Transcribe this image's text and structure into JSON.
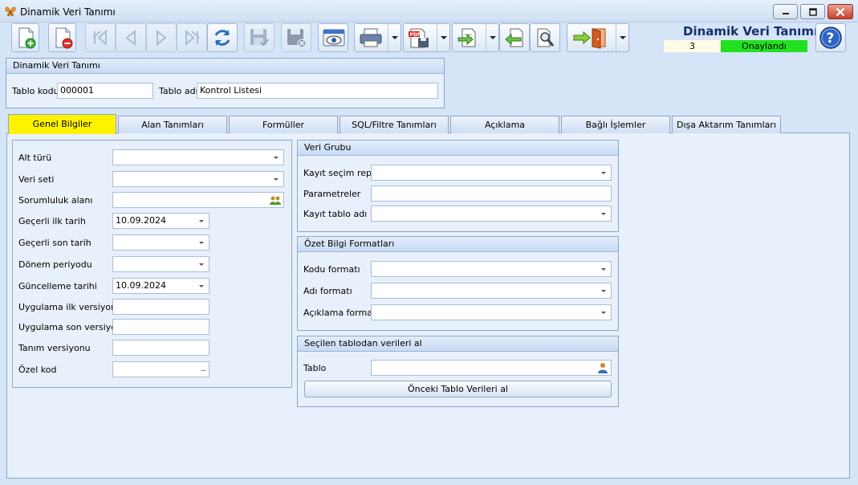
{
  "window": {
    "title": "Dinamik Veri Tanımı",
    "controls": [
      "minimize",
      "maximize",
      "close"
    ]
  },
  "toolbar": {
    "buttons": [
      {
        "icon": "new-document-icon",
        "enabled": true
      },
      {
        "icon": "delete-document-icon",
        "enabled": true
      },
      {
        "icon": "first-record-icon",
        "enabled": false
      },
      {
        "icon": "previous-record-icon",
        "enabled": false
      },
      {
        "icon": "next-record-icon",
        "enabled": false
      },
      {
        "icon": "last-record-icon",
        "enabled": false
      },
      {
        "icon": "refresh-icon",
        "enabled": true
      },
      {
        "icon": "save-icon",
        "enabled": false
      },
      {
        "icon": "save-cancel-icon",
        "enabled": false
      },
      {
        "icon": "preview-icon",
        "enabled": true
      },
      {
        "icon": "print-icon",
        "enabled": true,
        "dropdown": true
      },
      {
        "icon": "export-pdf-icon",
        "enabled": true,
        "dropdown": true
      },
      {
        "icon": "document-arrow-icon",
        "enabled": true,
        "dropdown": true
      },
      {
        "icon": "import-arrow-icon",
        "enabled": true
      },
      {
        "icon": "search-tools-icon",
        "enabled": true
      },
      {
        "icon": "exit-door-icon",
        "enabled": true,
        "dropdown": true
      }
    ]
  },
  "header": {
    "title": "Dinamik Veri Tanımı",
    "record_count": "3",
    "status": "Onaylandı",
    "status_color": "#22e11f"
  },
  "top_group": {
    "title": "Dinamik Veri Tanımı",
    "tablo_kodu_label": "Tablo kodu",
    "tablo_kodu_value": "000001",
    "tablo_adi_label": "Tablo adı",
    "tablo_adi_value": "Kontrol Listesi"
  },
  "tabs": [
    {
      "label": "Genel Bilgiler",
      "active": true
    },
    {
      "label": "Alan Tanımları",
      "active": false
    },
    {
      "label": "Formüller",
      "active": false
    },
    {
      "label": "SQL/Filtre Tanımları",
      "active": false
    },
    {
      "label": "Açıklama",
      "active": false
    },
    {
      "label": "Bağlı İşlemler",
      "active": false
    },
    {
      "label": "Dışa Aktarım Tanımları",
      "active": false
    }
  ],
  "general": {
    "fields": [
      {
        "label": "Alt türü",
        "value": "",
        "kind": "combo"
      },
      {
        "label": "Veri seti",
        "value": "",
        "kind": "combo"
      },
      {
        "label": "Sorumluluk alanı",
        "value": "",
        "kind": "lookup-users"
      },
      {
        "label": "Geçerli ilk tarih",
        "value": "10.09.2024",
        "kind": "date"
      },
      {
        "label": "Geçerli son tarih",
        "value": "",
        "kind": "date"
      },
      {
        "label": "Dönem periyodu",
        "value": "",
        "kind": "date"
      },
      {
        "label": "Güncelleme tarihi",
        "value": "10.09.2024",
        "kind": "date"
      },
      {
        "label": "Uygulama ilk versiyon",
        "value": "",
        "kind": "text"
      },
      {
        "label": "Uygulama son versiyon",
        "value": "",
        "kind": "text"
      },
      {
        "label": "Tanım versiyonu",
        "value": "",
        "kind": "text"
      },
      {
        "label": "Özel kod",
        "value": "",
        "kind": "ellipsis"
      }
    ],
    "ellipsis": "..."
  },
  "veri_grubu": {
    "title": "Veri Grubu",
    "fields": [
      {
        "label": "Kayıt seçim repo",
        "value": "",
        "kind": "combo"
      },
      {
        "label": "Parametreler",
        "value": "",
        "kind": "text"
      },
      {
        "label": "Kayıt tablo adı",
        "value": "",
        "kind": "combo"
      }
    ]
  },
  "ozet": {
    "title": "Özet Bilgi Formatları",
    "fields": [
      {
        "label": "Kodu formatı",
        "value": "",
        "kind": "combo"
      },
      {
        "label": "Adı formatı",
        "value": "",
        "kind": "combo"
      },
      {
        "label": "Açıklama formatı",
        "value": "",
        "kind": "combo"
      }
    ]
  },
  "secilen": {
    "title": "Seçilen tablodan verileri al",
    "tablo_label": "Tablo",
    "tablo_value": "",
    "button_label": "Önceki Tablo Verileri al"
  }
}
